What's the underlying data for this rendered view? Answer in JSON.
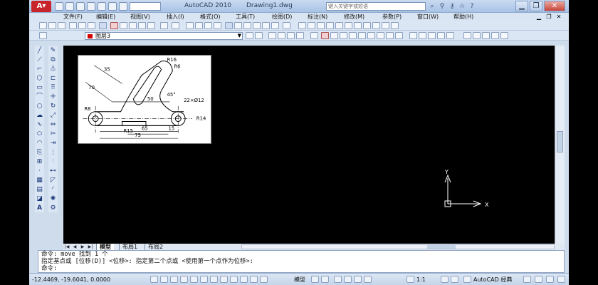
{
  "app": {
    "name": "AutoCAD 2010",
    "document": "Drawing1.dwg",
    "workspace_field": "",
    "search_placeholder": "键入关键字或短语",
    "window_controls": {
      "minimize": "▁",
      "maximize": "❐",
      "close": "✕"
    }
  },
  "menu": {
    "items": [
      "文件(F)",
      "编辑(E)",
      "视图(V)",
      "插入(I)",
      "格式(O)",
      "工具(T)",
      "绘图(D)",
      "标注(N)",
      "修改(M)",
      "参数(P)",
      "窗口(W)",
      "帮助(H)"
    ]
  },
  "layer": {
    "current": "图层3",
    "color": "#d20000"
  },
  "drawing": {
    "dimensions": [
      "35",
      "70",
      "R16",
      "R6",
      "50",
      "22×Ø12",
      "R14",
      "R15",
      "65",
      "15",
      "75",
      "R8",
      "45°"
    ]
  },
  "ucs": {
    "x_label": "X",
    "y_label": "Y"
  },
  "layout_tabs": {
    "model": "模型",
    "layout1": "布局1",
    "layout2": "布局2"
  },
  "command": {
    "lines": [
      "命令:  move 找到 1 个",
      "指定基点或 [位移(D)] <位移>:  指定第二个点或 <使用第一个点作为位移>:",
      "命令:"
    ]
  },
  "status": {
    "coords": "-12.4469,  -19.6041, 0.0000",
    "model": "模型",
    "scale": "1:1",
    "workspace": "AutoCAD 经典"
  },
  "colors": {
    "titlebar": "#b7cdea",
    "drawing_bg": "#000000",
    "ui_panel": "#dbe6f4"
  }
}
